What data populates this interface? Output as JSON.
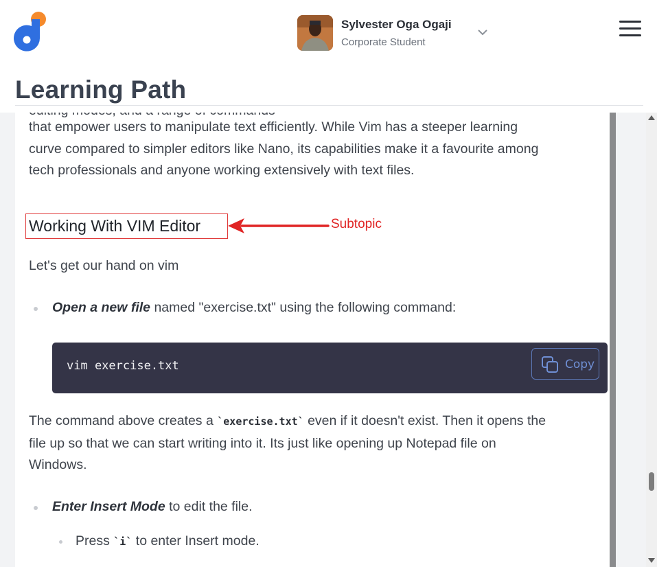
{
  "header": {
    "user_name": "Sylvester Oga Ogaji",
    "user_role": "Corporate Student"
  },
  "page": {
    "title": "Learning Path"
  },
  "content": {
    "cut_line": "editing modes, and a range of commands",
    "intro_paragraph_lines": [
      "that empower users to manipulate text efficiently. While Vim has a steeper learning",
      "curve compared to simpler editors like Nano, its capabilities make it a favourite among",
      "tech professionals and anyone working extensively with text files."
    ],
    "subtopic_heading": "Working With VIM Editor",
    "annotation_label": "Subtopic",
    "lead": "Let's get our hand on vim",
    "item1_bold": "Open a new file",
    "item1_rest": " named \"exercise.txt\" using the following command:",
    "code": "vim exercise.txt",
    "copy_label": "Copy",
    "para2_line1_a": "The command above creates a ",
    "para2_code": "`exercise.txt`",
    "para2_line1_b": " even if it doesn't exist. Then it opens the",
    "para2_line2": "file up so that we can start writing into it. Its just like opening up Notepad file on",
    "para2_line3": "Windows.",
    "item2_bold": "Enter Insert Mode",
    "item2_rest": " to edit the file.",
    "sub_item_a": "Press ",
    "sub_item_code": "`i`",
    "sub_item_b": " to enter Insert mode."
  },
  "colors": {
    "accent_blue": "#2f6fe0",
    "accent_orange": "#f58a2c",
    "annotation_red": "#e02424",
    "code_bg": "#343447"
  },
  "icons": [
    "logo-icon",
    "chevron-down-icon",
    "hamburger-menu-icon",
    "copy-icon"
  ]
}
